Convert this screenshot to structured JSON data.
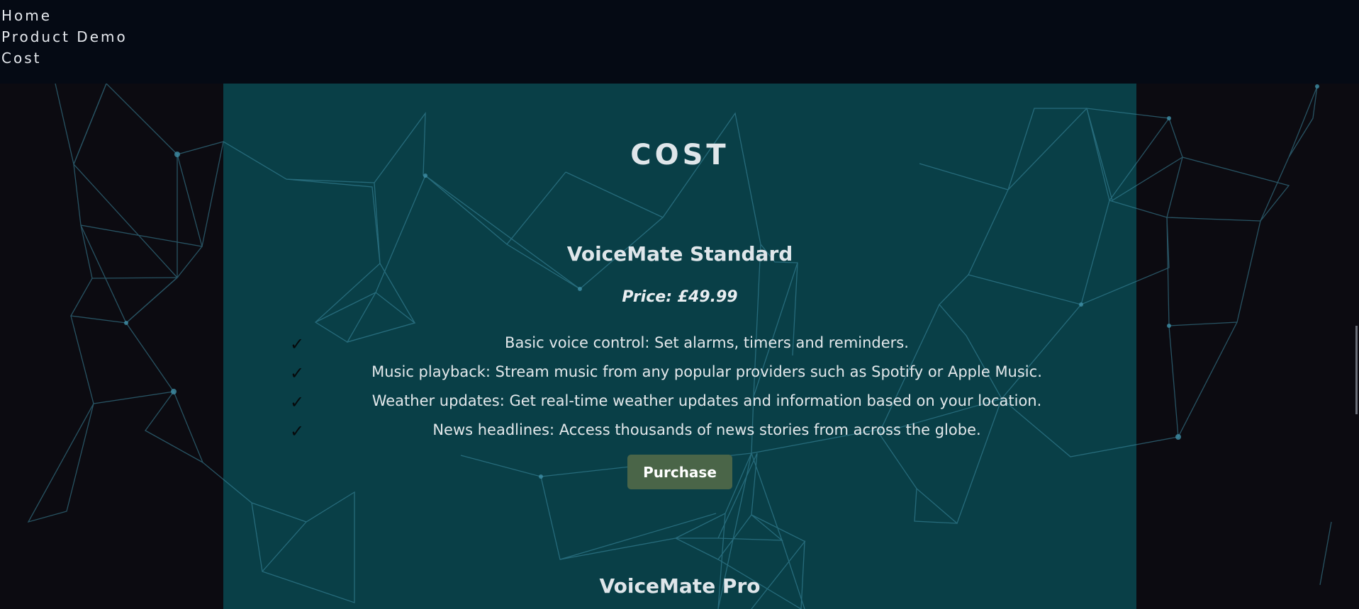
{
  "nav": {
    "items": [
      "Home",
      "Product Demo",
      "Cost"
    ]
  },
  "section": {
    "title": "COST"
  },
  "plans": [
    {
      "name": "VoiceMate Standard",
      "price": "Price: £49.99",
      "features": [
        "Basic voice control: Set alarms, timers and reminders.",
        "Music playback: Stream music from any popular providers such as Spotify or Apple Music.",
        "Weather updates: Get real-time weather updates and information based on your location.",
        "News headlines: Access thousands of news stories from across the globe."
      ],
      "button_label": "Purchase"
    },
    {
      "name": "VoiceMate Pro"
    }
  ],
  "icons": {
    "check": "✓"
  },
  "colors": {
    "nav_bg": "#050a14",
    "panel_bg": "#093f47",
    "button_bg": "#4a6548",
    "network_line": "#3f8fa6"
  }
}
